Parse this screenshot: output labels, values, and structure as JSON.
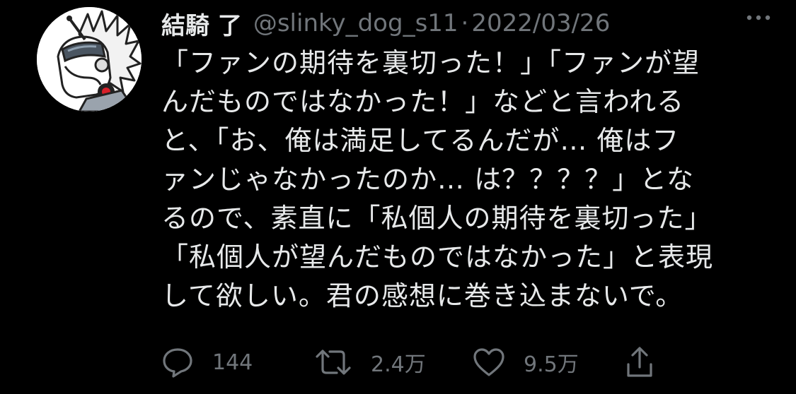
{
  "tweet": {
    "display_name": "結騎 了",
    "handle": "@slinky_dog_s11",
    "separator": "·",
    "date": "2022/03/26",
    "more_icon": "more-horizontal-icon",
    "avatar": "mecha-dog-avatar",
    "lines": [
      "「ファンの期待を裏切った！」「ファンが望",
      "んだものではなかった！」などと言われる",
      "と、「お、俺は満足してるんだが…  俺はフ",
      "ァンじゃなかったのか…  は？？？？」とな",
      "るので、素直に「私個人の期待を裏切った」",
      "「私個人が望んだものではなかった」と表現",
      "して欲しい。君の感想に巻き込まないで。"
    ],
    "actions": {
      "reply": {
        "icon": "reply-icon",
        "count": "144"
      },
      "retweet": {
        "icon": "retweet-icon",
        "count": "2.4万"
      },
      "like": {
        "icon": "heart-icon",
        "count": "9.5万"
      },
      "share": {
        "icon": "share-icon"
      }
    },
    "colors": {
      "background": "#000000",
      "text": "#e7e9ea",
      "secondary": "#71767b"
    }
  }
}
